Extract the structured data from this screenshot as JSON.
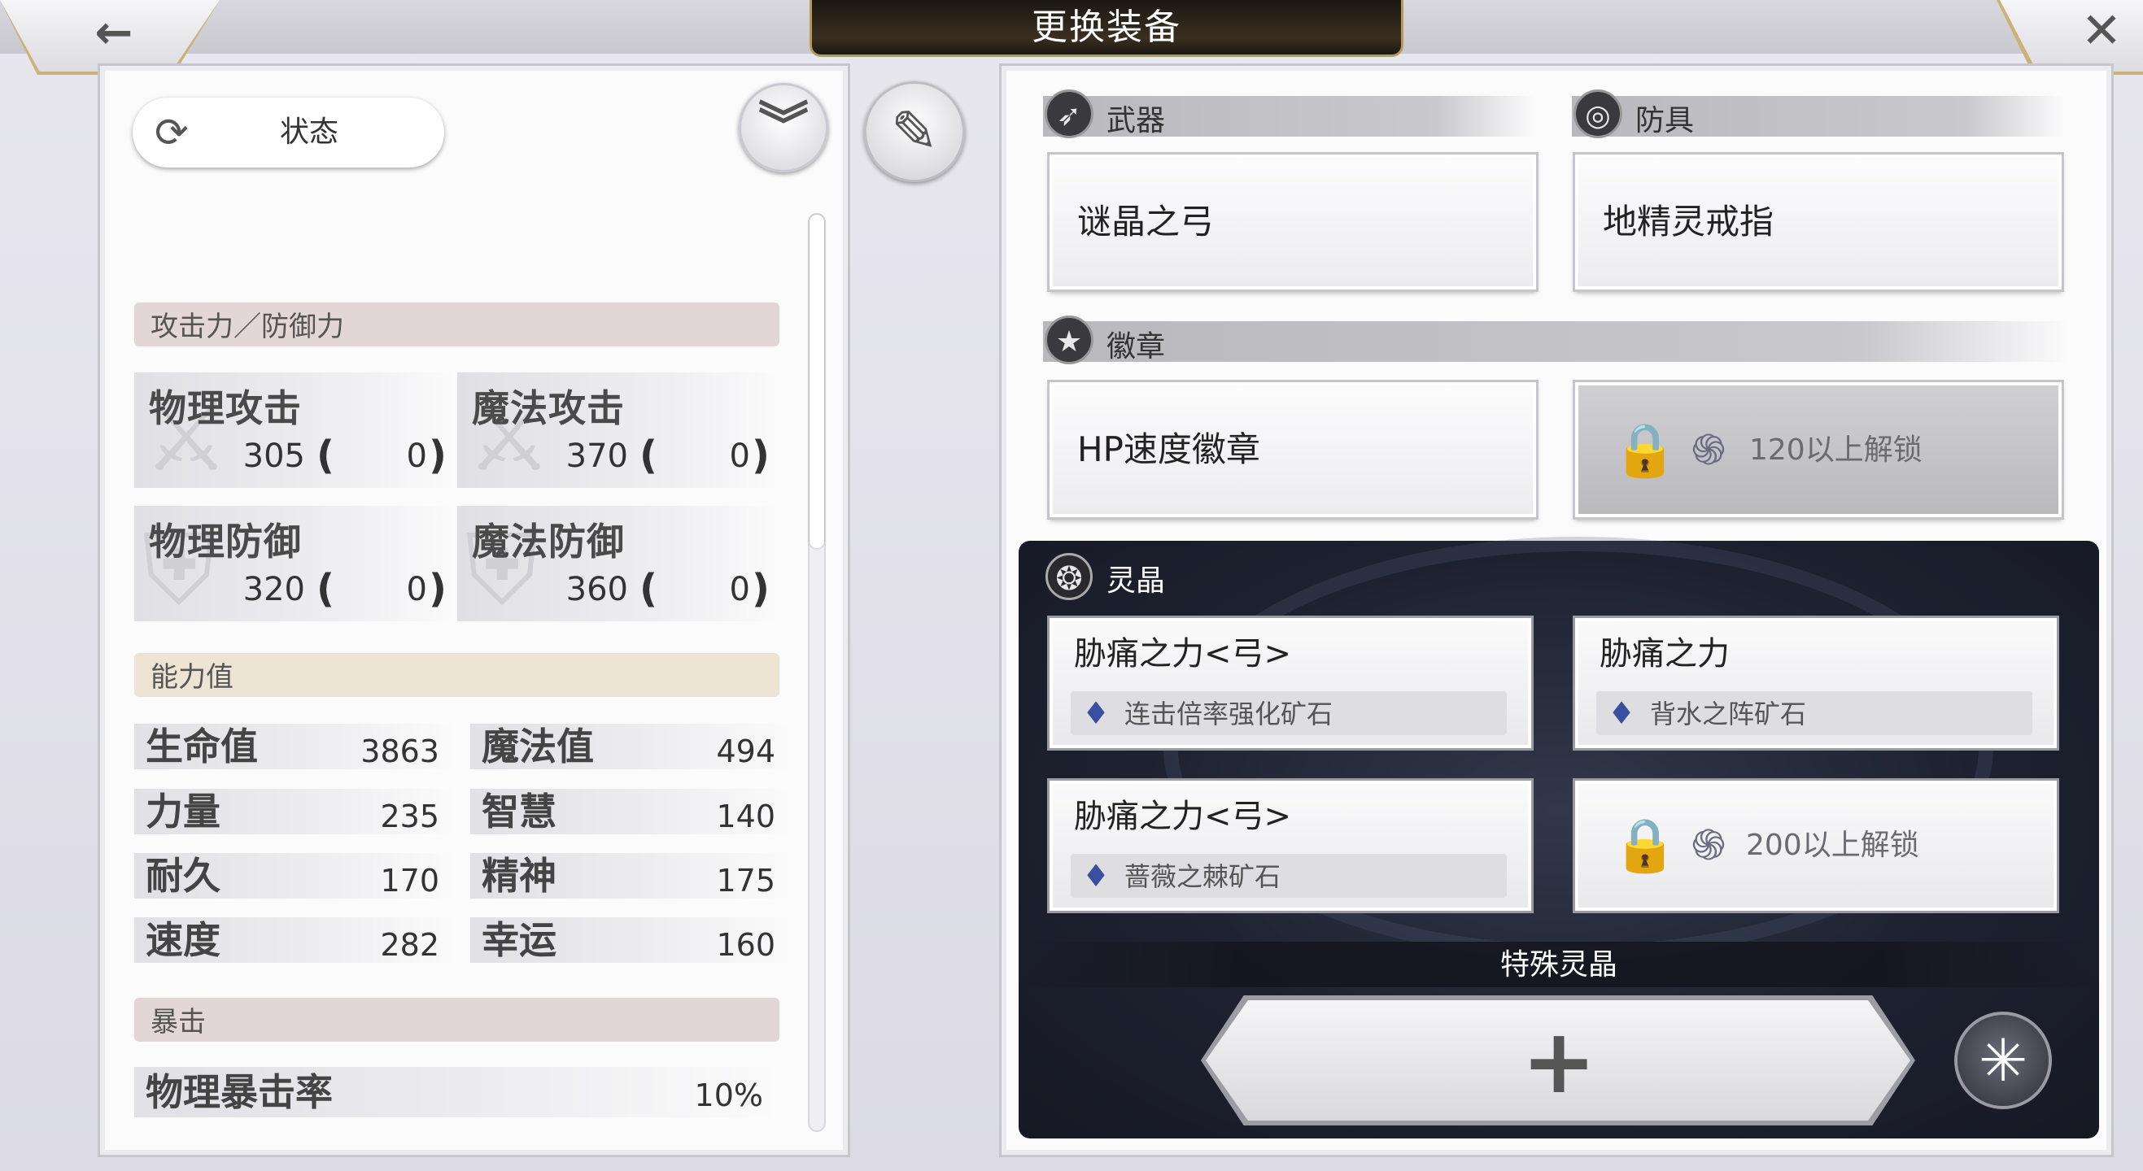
{
  "header": {
    "title": "更换装备"
  },
  "left": {
    "status_label": "状态",
    "sections": {
      "atk_def": "攻击力／防御力",
      "ability": "能力值",
      "crit": "暴击"
    },
    "combat_stats": [
      {
        "name": "物理攻击",
        "value": "305",
        "bonus": "0"
      },
      {
        "name": "魔法攻击",
        "value": "370",
        "bonus": "0"
      },
      {
        "name": "物理防御",
        "value": "320",
        "bonus": "0"
      },
      {
        "name": "魔法防御",
        "value": "360",
        "bonus": "0"
      }
    ],
    "open_paren": "(",
    "close_paren": ")",
    "abilities": [
      {
        "name": "生命值",
        "value": "3863"
      },
      {
        "name": "魔法值",
        "value": "494"
      },
      {
        "name": "力量",
        "value": "235"
      },
      {
        "name": "智慧",
        "value": "140"
      },
      {
        "name": "耐久",
        "value": "170"
      },
      {
        "name": "精神",
        "value": "175"
      },
      {
        "name": "速度",
        "value": "282"
      },
      {
        "name": "幸运",
        "value": "160"
      }
    ],
    "crit_row": {
      "name": "物理暴击率",
      "value": "10%"
    }
  },
  "right": {
    "weapon": {
      "label": "武器",
      "item": "谜晶之弓"
    },
    "armor": {
      "label": "防具",
      "item": "地精灵戒指"
    },
    "badge": {
      "label": "徽章",
      "item": "HP速度徽章",
      "locked_text": "120以上解锁"
    },
    "crystal": {
      "label": "灵晶",
      "slots": [
        {
          "name": "胁痛之力<弓>",
          "ore": "连击倍率强化矿石"
        },
        {
          "name": "胁痛之力",
          "ore": "背水之阵矿石"
        },
        {
          "name": "胁痛之力<弓>",
          "ore": "蔷薇之棘矿石"
        }
      ],
      "locked_text": "200以上解锁",
      "special_label": "特殊灵晶"
    }
  },
  "icons": {
    "back": "←",
    "close": "✕",
    "refresh": "⟳",
    "chevron": "︾",
    "memo": "✎",
    "weapon": "➶",
    "armor": "◎",
    "badge": "★",
    "crystal": "❂",
    "lock": "🔒",
    "swirl": "֍",
    "ore": "♦",
    "plus": "+",
    "burst": "✳"
  }
}
